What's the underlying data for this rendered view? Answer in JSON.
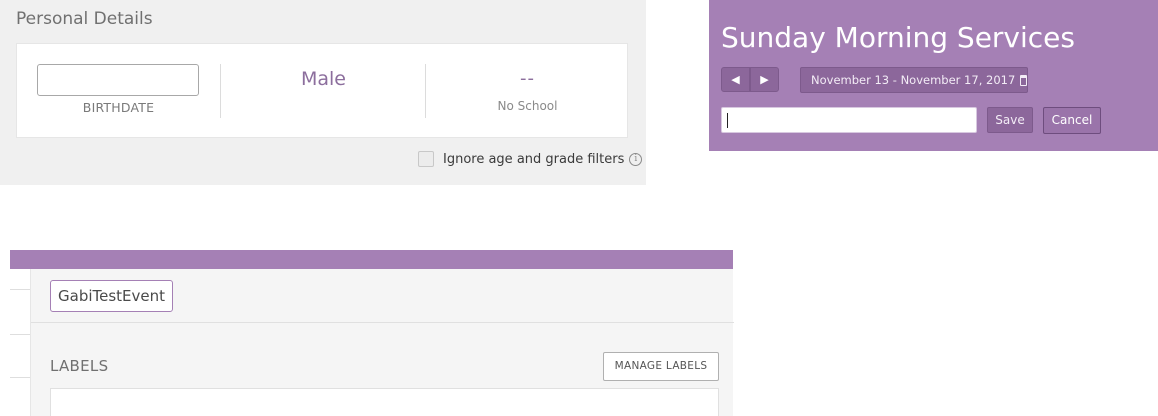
{
  "personal_details": {
    "title": "Personal Details",
    "birthdate": {
      "value": "",
      "label": "BIRTHDATE"
    },
    "gender": {
      "value": "Male"
    },
    "school": {
      "value": "--",
      "label": "No School"
    },
    "ignore_filters": {
      "label": "Ignore age and grade filters",
      "checked": false,
      "icon": "info-icon"
    }
  },
  "service": {
    "title": "Sunday Morning Services",
    "prev_icon": "◀",
    "next_icon": "▶",
    "date_range": "November 13 - November 17, 2017",
    "name_input_value": "",
    "save_label": "Save",
    "cancel_label": "Cancel",
    "accent_color": "#a580b5"
  },
  "event": {
    "name": "GabiTestEvent",
    "labels_heading": "LABELS",
    "manage_labels_button": "MANAGE LABELS"
  }
}
